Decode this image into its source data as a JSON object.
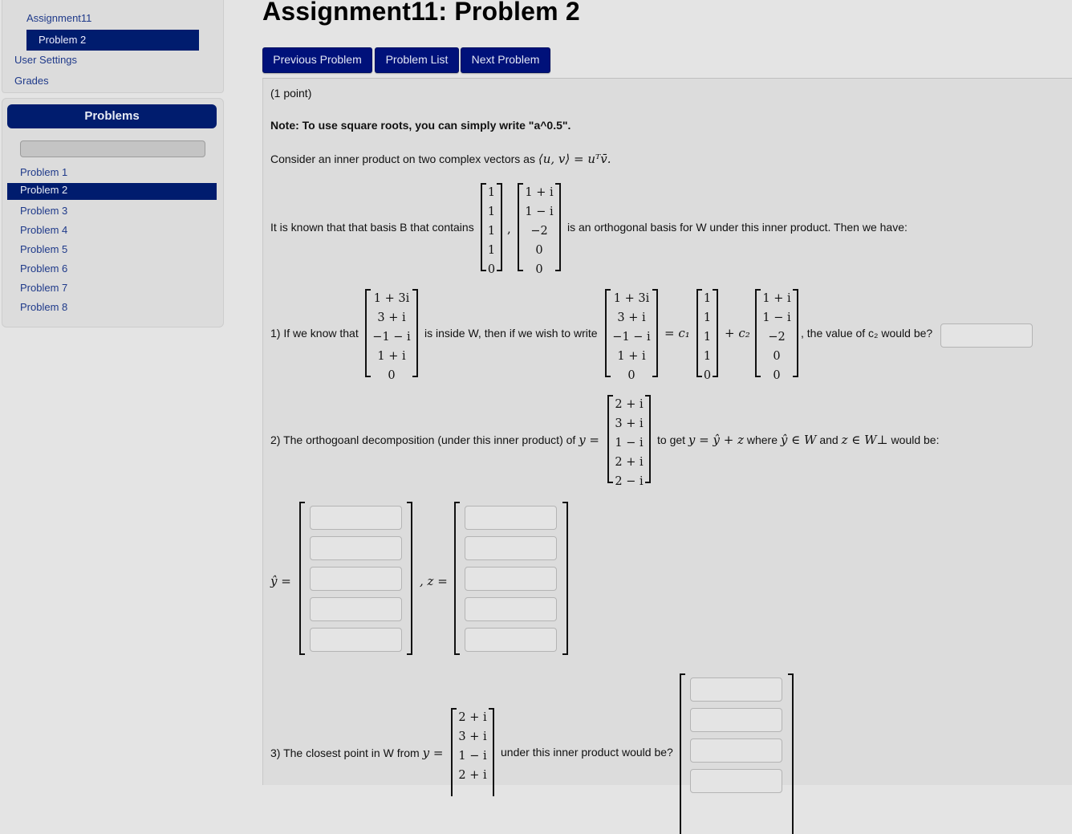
{
  "sidebar": {
    "nav": {
      "assignment": "Assignment11",
      "current_problem": "Problem 2",
      "user_settings": "User Settings",
      "grades": "Grades"
    },
    "problems_panel": {
      "title": "Problems",
      "search_value": "",
      "items": [
        {
          "label": "Problem 1",
          "active": false
        },
        {
          "label": "Problem 2",
          "active": true
        },
        {
          "label": "Problem 3",
          "active": false
        },
        {
          "label": "Problem 4",
          "active": false
        },
        {
          "label": "Problem 5",
          "active": false
        },
        {
          "label": "Problem 6",
          "active": false
        },
        {
          "label": "Problem 7",
          "active": false
        },
        {
          "label": "Problem 8",
          "active": false
        }
      ]
    }
  },
  "header": {
    "title": "Assignment11: Problem 2",
    "buttons": {
      "previous": "Previous Problem",
      "list": "Problem List",
      "next": "Next Problem"
    }
  },
  "problem": {
    "points": "(1 point)",
    "note": "Note: To use square roots, you can simply write \"a^0.5\".",
    "intro_text": "Consider an inner product on two complex vectors as",
    "intro_math": "⟨u, v⟩ = uᵀv̄.",
    "basis_text_before": "It is known that that basis B that contains",
    "basis_text_after": "is an orthogonal basis for W under this inner product. Then we have:",
    "basis_vectors": [
      [
        "1",
        "1",
        "1",
        "1",
        "0"
      ],
      [
        "1 + i",
        "1 − i",
        "−2",
        "0",
        "0"
      ]
    ],
    "comma": ",",
    "q1": {
      "prefix": "1) If we know that",
      "middle": "is inside W, then if we wish to write",
      "vector": [
        "1 + 3i",
        "3 + i",
        "−1 − i",
        "1 + i",
        "0"
      ],
      "eq_c1": "= c₁",
      "plus_c2": "+ c₂",
      "suffix": ", the value of c₂ would be?",
      "answer_value": ""
    },
    "q2": {
      "prefix": "2) The orthogoanl decomposition (under this inner product) of",
      "y_eq": "y =",
      "suffix_1": "to get",
      "suffix_math_1": "y = ŷ + z",
      "suffix_2": "where",
      "suffix_math_2": "ŷ ∈ W",
      "suffix_3": "and",
      "suffix_math_3": "z ∈ W⊥",
      "suffix_4": "would be:",
      "y_vector": [
        "2 + i",
        "3 + i",
        "1 − i",
        "2 + i",
        "2 − i"
      ],
      "yhat_label": "ŷ =",
      "z_label": ", z =",
      "yhat_answers": [
        "",
        "",
        "",
        "",
        ""
      ],
      "z_answers": [
        "",
        "",
        "",
        "",
        ""
      ]
    },
    "q3": {
      "prefix": "3) The closest point in W from",
      "y_eq": "y =",
      "y_vector_visible": [
        "2 + i",
        "3 + i",
        "1 − i",
        "2 + i"
      ],
      "suffix": "under this inner product would be?",
      "answers_visible": [
        "",
        "",
        "",
        ""
      ]
    }
  }
}
